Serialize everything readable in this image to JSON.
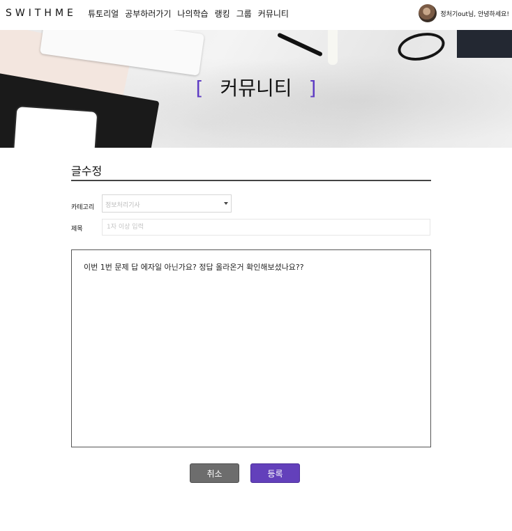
{
  "nav": {
    "logo": "SWITHME",
    "menu": [
      "튜토리얼",
      "공부하러가기",
      "나의학습",
      "랭킹",
      "그룹",
      "커뮤니티"
    ],
    "greeting": "정처기out님, 안녕하세요!"
  },
  "banner": {
    "bracket_open": "[",
    "title": "커뮤니티",
    "bracket_close": "]"
  },
  "form": {
    "heading": "글수정",
    "category_label": "카테고리",
    "category_value": "정보처리기사",
    "subject_label": "제목",
    "subject_placeholder": "1자 이상 입력",
    "body_text": "이번 1번 문제 답 에자일 아닌가요? 정답 올라온거 확인해보셨나요??"
  },
  "buttons": {
    "cancel": "취소",
    "submit": "등록"
  },
  "colors": {
    "accent": "#6340bb",
    "cancel": "#6d6d6d"
  }
}
